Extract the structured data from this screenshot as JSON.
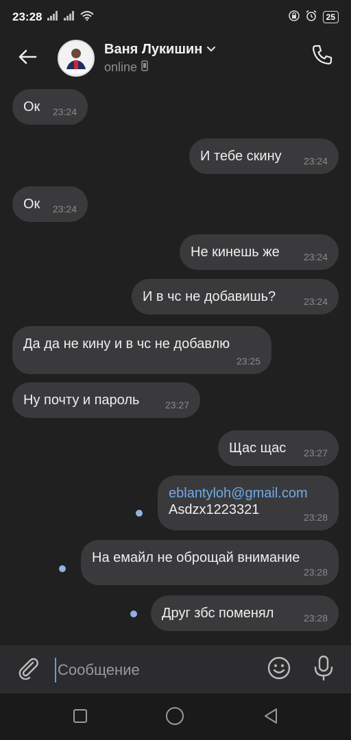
{
  "status_bar": {
    "time": "23:28",
    "battery": "25",
    "icons": [
      "signal-icon",
      "signal-icon",
      "wifi-icon",
      "lock-icon",
      "alarm-icon",
      "battery-icon"
    ]
  },
  "header": {
    "contact_name": "Ваня Лукишин",
    "contact_status": "online",
    "icons": [
      "back-arrow-icon",
      "chevron-down-icon",
      "phone-device-icon",
      "call-icon"
    ]
  },
  "messages": [
    {
      "direction": "in",
      "text": "Ок",
      "time": "23:24"
    },
    {
      "direction": "out",
      "text": "И тебе скину",
      "time": "23:24"
    },
    {
      "direction": "in",
      "text": "Ок",
      "time": "23:24"
    },
    {
      "direction": "out",
      "text": "Не кинешь же",
      "time": "23:24"
    },
    {
      "direction": "out",
      "text": "И в чс не добавишь?",
      "time": "23:24"
    },
    {
      "direction": "in",
      "text": "Да да не кину и в чс не добавлю",
      "time": "23:25"
    },
    {
      "direction": "in",
      "text": "Ну почту и пароль",
      "time": "23:27"
    },
    {
      "direction": "out",
      "text": "Щас щас",
      "time": "23:27"
    },
    {
      "direction": "out",
      "link": "eblantyloh@gmail.com",
      "text": "Asdzx1223321",
      "time": "23:28",
      "unread": true
    },
    {
      "direction": "out",
      "text": "На емайл не оброщай внимание",
      "time": "23:28",
      "unread": true
    },
    {
      "direction": "out",
      "text": "Друг збс поменял",
      "time": "23:28",
      "unread": true
    }
  ],
  "composer": {
    "placeholder": "Сообщение",
    "icons": [
      "attach-icon",
      "emoji-icon",
      "mic-icon"
    ]
  },
  "nav_bar": {
    "icons": [
      "recent-apps-icon",
      "home-icon",
      "back-icon"
    ]
  },
  "colors": {
    "background": "#202020",
    "bubble": "#3a3a3c",
    "link": "#71aaeb",
    "unread_dot": "#8fb3df",
    "composer": "#2c2c2e"
  }
}
